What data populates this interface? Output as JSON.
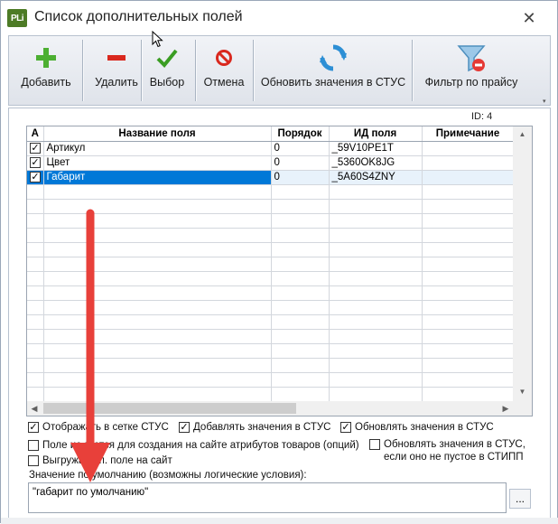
{
  "window": {
    "title": "Список дополнительных полей",
    "logo_text": "PLi",
    "close_symbol": "✕"
  },
  "toolbar": {
    "buttons": [
      {
        "label": "Добавить",
        "icon": "plus-icon"
      },
      {
        "label": "Удалить",
        "icon": "minus-icon"
      },
      {
        "label": "Выбор",
        "icon": "checkmark-icon"
      },
      {
        "label": "Отмена",
        "icon": "cancel-icon"
      },
      {
        "label": "Обновить значения в СТУС",
        "icon": "refresh-icon"
      },
      {
        "label": "Фильтр по прайсу",
        "icon": "filter-icon"
      }
    ]
  },
  "record_id": "ID: 4",
  "grid": {
    "columns": [
      "A",
      "Название поля",
      "Порядок",
      "ИД поля",
      "Примечание"
    ],
    "rows": [
      {
        "active": true,
        "name": "Артикул",
        "order": "0",
        "id": "_59V10PE1T",
        "note": "",
        "selected": false
      },
      {
        "active": true,
        "name": "Цвет",
        "order": "0",
        "id": "_5360OK8JG",
        "note": "",
        "selected": false
      },
      {
        "active": true,
        "name": "Габарит",
        "order": "0",
        "id": "_5A60S4ZNY",
        "note": "",
        "selected": true
      }
    ]
  },
  "options": {
    "show_in_grid": {
      "label": "Отображать в сетке СТУС",
      "checked": true
    },
    "add_values": {
      "label": "Добавлять значения в СТУС",
      "checked": true
    },
    "update_values": {
      "label": "Обновлять значения в СТУС",
      "checked": true
    },
    "field_used": {
      "label": "Поле ис   зуется для создания на сайте атрибутов товаров (опций)",
      "checked": false
    },
    "update_if_not_empty": {
      "label": "Обновлять значения в СТУС, если оно не пустое в СТИПП",
      "checked": false
    },
    "export_field": {
      "label": "Выгружа    доп. поле на сайт",
      "checked": false
    }
  },
  "default_value": {
    "label": "Значение по умолчанию (возможны логические условия):",
    "value": "\"габарит по умолчанию\"",
    "browse_label": "..."
  },
  "colors": {
    "selection": "#0078d7",
    "annotation_arrow": "#e8403a",
    "plus_green": "#4caf32",
    "minus_red": "#d9281e"
  }
}
